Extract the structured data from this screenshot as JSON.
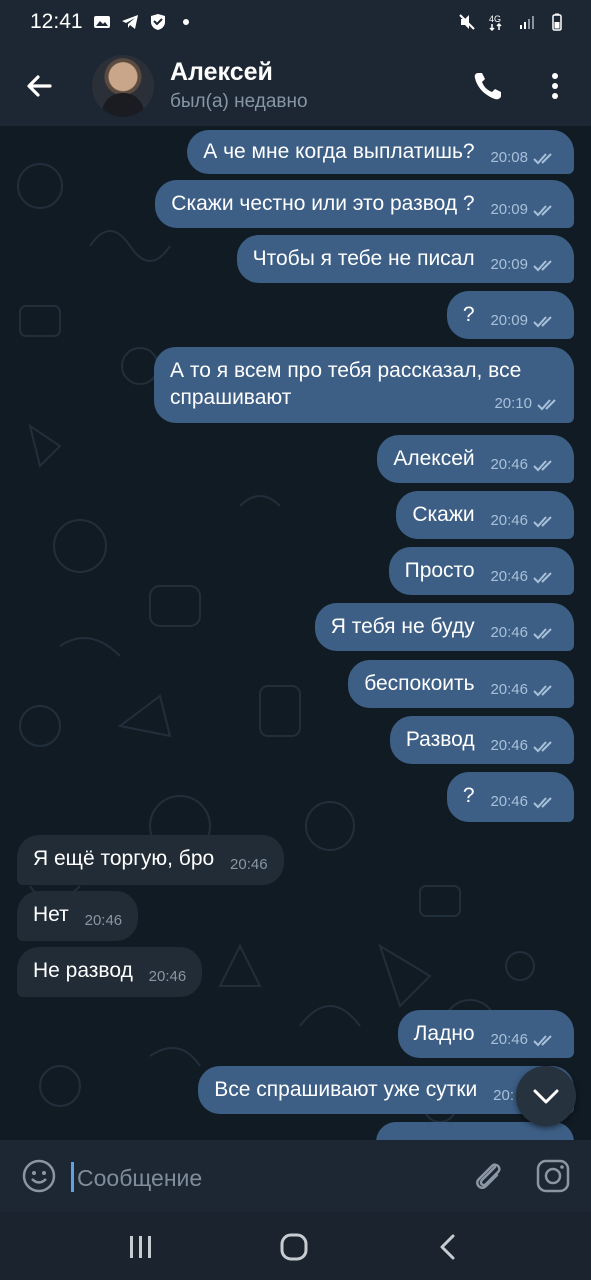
{
  "status_bar": {
    "time": "12:41",
    "icons_left": [
      "gallery-icon",
      "telegram-icon",
      "shield-icon",
      "dot-icon"
    ],
    "icons_right": [
      "mute-icon",
      "4g-signal-icon",
      "signal-bars-icon",
      "battery-icon"
    ]
  },
  "header": {
    "name": "Алексей",
    "status": "был(а) недавно",
    "icons": [
      "back-arrow-icon",
      "phone-icon",
      "more-vertical-icon"
    ]
  },
  "messages": [
    {
      "dir": "out",
      "text": "А че мне когда выплатишь?",
      "time": "20:08"
    },
    {
      "dir": "out",
      "text": "Скажи честно или это развод ?",
      "time": "20:09"
    },
    {
      "dir": "out",
      "text": "Чтобы я тебе не писал",
      "time": "20:09"
    },
    {
      "dir": "out",
      "text": "?",
      "time": "20:09"
    },
    {
      "dir": "out",
      "text": "А то я всем про тебя рассказал, все спрашивают",
      "time": "20:10"
    },
    {
      "dir": "out",
      "text": "Алексей",
      "time": "20:46"
    },
    {
      "dir": "out",
      "text": "Скажи",
      "time": "20:46"
    },
    {
      "dir": "out",
      "text": "Просто",
      "time": "20:46"
    },
    {
      "dir": "out",
      "text": "Я тебя не буду",
      "time": "20:46"
    },
    {
      "dir": "out",
      "text": "беспокоить",
      "time": "20:46"
    },
    {
      "dir": "out",
      "text": "Развод",
      "time": "20:46"
    },
    {
      "dir": "out",
      "text": "?",
      "time": "20:46"
    },
    {
      "dir": "in",
      "text": "Я ещё торгую, бро",
      "time": "20:46"
    },
    {
      "dir": "in",
      "text": "Нет",
      "time": "20:46"
    },
    {
      "dir": "in",
      "text": "Не развод",
      "time": "20:46"
    },
    {
      "dir": "out",
      "text": "Ладно",
      "time": "20:46"
    },
    {
      "dir": "out",
      "text": "Все спрашивают уже сутки",
      "time": "20:"
    }
  ],
  "composer": {
    "placeholder": "Сообщение",
    "icons": [
      "emoji-icon",
      "paperclip-icon",
      "camera-icon"
    ]
  },
  "colors": {
    "outgoing_bubble": "#3d5f86",
    "incoming_bubble": "#212c37",
    "header_bg": "#1d2733",
    "chat_bg": "#111b24",
    "read_check": "#a8c0d9"
  }
}
